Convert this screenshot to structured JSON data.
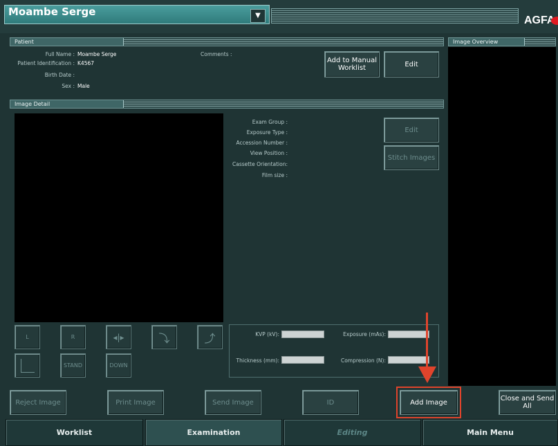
{
  "title": {
    "patient_name": "Moambe Serge",
    "brand": "AGFA",
    "brand_logo": "Agfa"
  },
  "patient_panel": {
    "header": "Patient",
    "fields": [
      {
        "label": "Full Name :",
        "value": "Moambe Serge"
      },
      {
        "label": "Patient Identification :",
        "value": "K4567"
      },
      {
        "label": "Birth Date :",
        "value": ""
      },
      {
        "label": "Sex :",
        "value": "Male"
      }
    ],
    "comments_label": "Comments :",
    "add_worklist_button": "Add to Manual Worklist",
    "edit_button": "Edit"
  },
  "overview_panel": {
    "header": "Image Overview"
  },
  "detail_panel": {
    "header": "Image Detail",
    "fields": [
      "Exam Group :",
      "Exposure Type :",
      "Accession Number :",
      "View Position :",
      "Cassette Orientation:",
      "Film size :"
    ],
    "edit_button": "Edit",
    "stitch_button": "Stitch Images"
  },
  "tools": {
    "left": "L",
    "right": "R",
    "stand": "STAND",
    "down": "DOWN"
  },
  "exposure": {
    "kvp_label": "KVP (kV):",
    "exposure_label": "Exposure (mAs):",
    "thickness_label": "Thickness (mm):",
    "compression_label": "Compression (N):"
  },
  "actions": {
    "reject": "Reject Image",
    "print": "Print Image",
    "send": "Send Image",
    "id": "ID",
    "add_image": "Add Image",
    "close_send": "Close and Send All"
  },
  "nav": {
    "worklist": "Worklist",
    "examination": "Examination",
    "editing": "Editing",
    "main_menu": "Main Menu"
  },
  "colors": {
    "highlight": "#e0442c",
    "background": "#1f3434"
  }
}
